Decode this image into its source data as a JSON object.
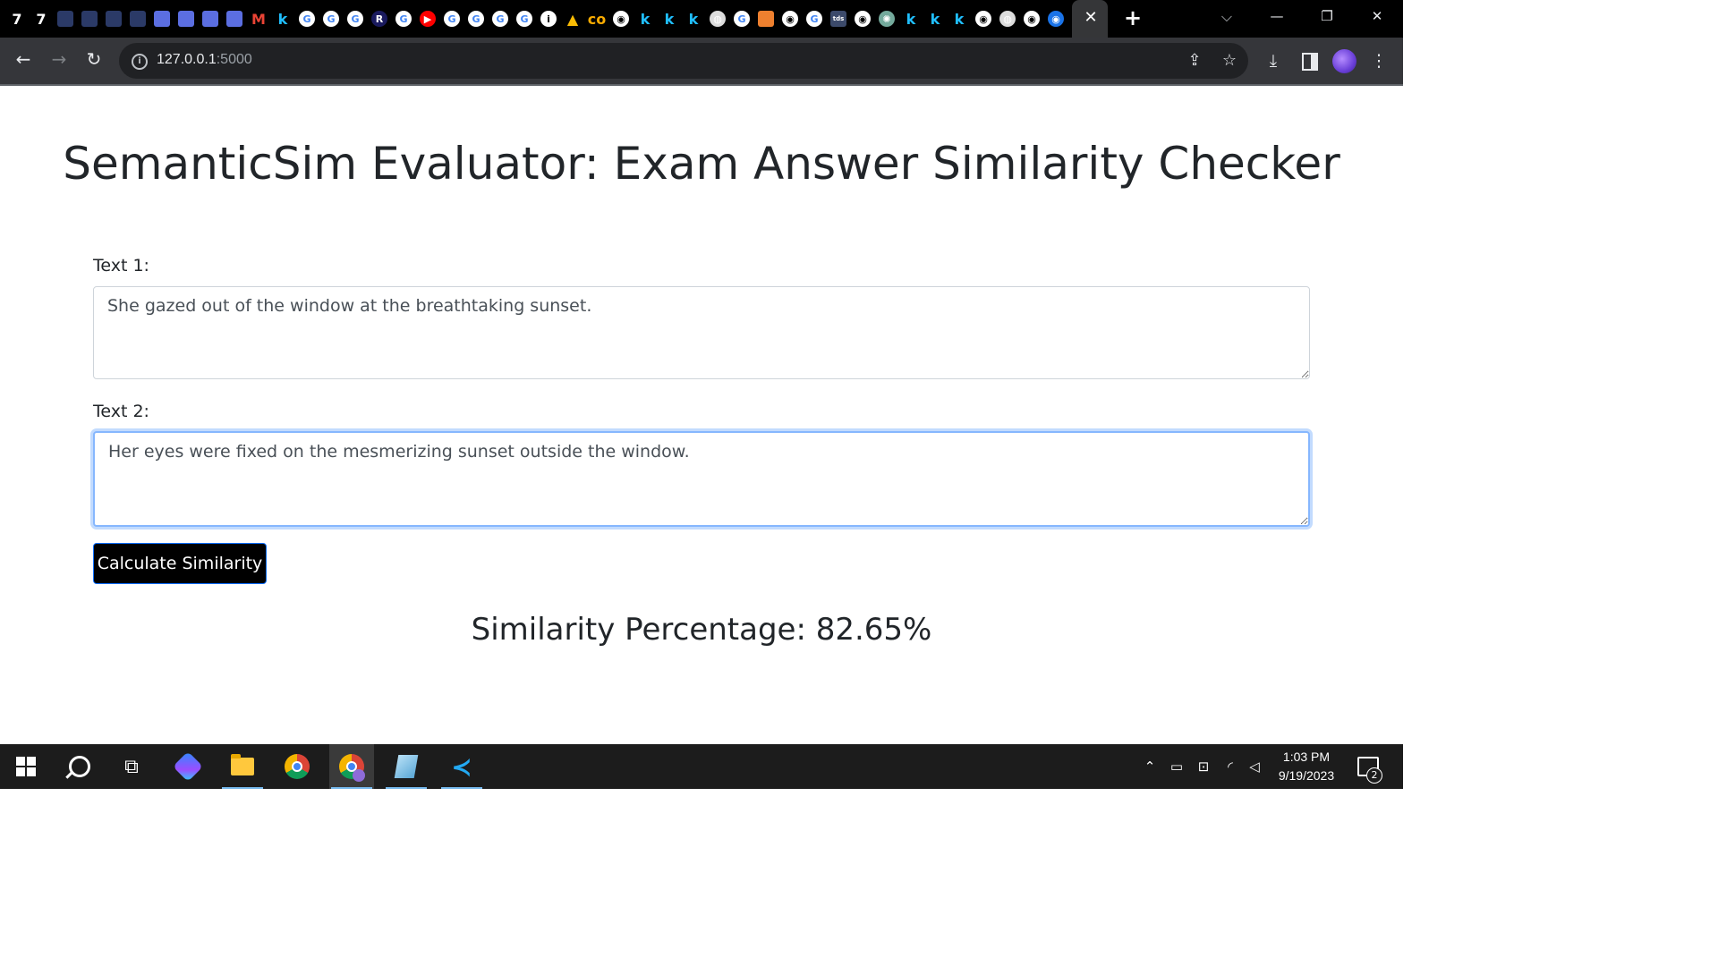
{
  "browser": {
    "active_tab_close": "✕",
    "new_tab": "+",
    "url_host": "127.0.0.1",
    "url_port": ":5000",
    "window_controls": [
      "minimize",
      "restore",
      "close"
    ]
  },
  "tabs_favicons": [
    {
      "icon": "seven-icon",
      "text": "7",
      "bg": "transparent"
    },
    {
      "icon": "seven-icon",
      "text": "7",
      "bg": "transparent"
    },
    {
      "icon": "app-icon",
      "text": "",
      "bg": "#2b3a67"
    },
    {
      "icon": "app-icon",
      "text": "",
      "bg": "#2b3a67"
    },
    {
      "icon": "app-icon",
      "text": "",
      "bg": "#2b3a67"
    },
    {
      "icon": "app-icon",
      "text": "",
      "bg": "#2b3a67"
    },
    {
      "icon": "doc-icon",
      "text": "",
      "bg": "#5b6ee1"
    },
    {
      "icon": "doc-icon",
      "text": "",
      "bg": "#5b6ee1"
    },
    {
      "icon": "doc-icon",
      "text": "",
      "bg": "#5b6ee1"
    },
    {
      "icon": "doc-icon",
      "text": "",
      "bg": "#5b6ee1"
    },
    {
      "icon": "gmail-icon",
      "text": "M",
      "bg": "transparent"
    },
    {
      "icon": "kaggle-icon",
      "text": "k",
      "bg": "transparent"
    },
    {
      "icon": "google-icon",
      "text": "G",
      "bg": "#ffffff"
    },
    {
      "icon": "google-icon",
      "text": "G",
      "bg": "#ffffff"
    },
    {
      "icon": "google-icon",
      "text": "G",
      "bg": "#ffffff"
    },
    {
      "icon": "r-icon",
      "text": "R",
      "bg": "#1a1a5e"
    },
    {
      "icon": "google-icon",
      "text": "G",
      "bg": "#ffffff"
    },
    {
      "icon": "youtube-icon",
      "text": "▶",
      "bg": "#ff0000"
    },
    {
      "icon": "google-icon",
      "text": "G",
      "bg": "#ffffff"
    },
    {
      "icon": "google-icon",
      "text": "G",
      "bg": "#ffffff"
    },
    {
      "icon": "google-icon",
      "text": "G",
      "bg": "#ffffff"
    },
    {
      "icon": "google-icon",
      "text": "G",
      "bg": "#ffffff"
    },
    {
      "icon": "info-icon",
      "text": "i",
      "bg": "#ffffff"
    },
    {
      "icon": "drive-icon",
      "text": "▲",
      "bg": "transparent"
    },
    {
      "icon": "colab-icon",
      "text": "co",
      "bg": "transparent"
    },
    {
      "icon": "github-icon",
      "text": "◉",
      "bg": "#ffffff"
    },
    {
      "icon": "kaggle-icon",
      "text": "k",
      "bg": "transparent"
    },
    {
      "icon": "kaggle-icon",
      "text": "k",
      "bg": "transparent"
    },
    {
      "icon": "kaggle-icon",
      "text": "k",
      "bg": "transparent"
    },
    {
      "icon": "globe-icon",
      "text": "◍",
      "bg": "#dddddd"
    },
    {
      "icon": "google-icon",
      "text": "G",
      "bg": "#ffffff"
    },
    {
      "icon": "rss-icon",
      "text": "",
      "bg": "#ee802f"
    },
    {
      "icon": "github-icon",
      "text": "◉",
      "bg": "#ffffff"
    },
    {
      "icon": "google-icon",
      "text": "G",
      "bg": "#ffffff"
    },
    {
      "icon": "tds-icon",
      "text": "tds",
      "bg": "#3c4a6b"
    },
    {
      "icon": "github-icon",
      "text": "◉",
      "bg": "#ffffff"
    },
    {
      "icon": "chatgpt-icon",
      "text": "✺",
      "bg": "#74aa9c"
    },
    {
      "icon": "kaggle-icon",
      "text": "k",
      "bg": "transparent"
    },
    {
      "icon": "kaggle-icon",
      "text": "k",
      "bg": "transparent"
    },
    {
      "icon": "kaggle-icon",
      "text": "k",
      "bg": "transparent"
    },
    {
      "icon": "github-icon",
      "text": "◉",
      "bg": "#ffffff"
    },
    {
      "icon": "globe-icon",
      "text": "◍",
      "bg": "#dddddd"
    },
    {
      "icon": "github-icon",
      "text": "◉",
      "bg": "#ffffff"
    },
    {
      "icon": "profile-icon",
      "text": "◉",
      "bg": "#1a73e8"
    }
  ],
  "page": {
    "title": "SemanticSim Evaluator: Exam Answer Similarity Checker",
    "text1_label": "Text 1:",
    "text1_value": "She gazed out of the window at the breathtaking sunset.",
    "text2_label": "Text 2:",
    "text2_value": "Her eyes were fixed on the mesmerizing sunset outside the window.",
    "button_label": "Calculate Similarity",
    "result": "Similarity Percentage: 82.65%"
  },
  "taskbar": {
    "time": "1:03 PM",
    "date": "9/19/2023",
    "notification_count": "2"
  },
  "colors": {
    "tab_strip_bg": "#000000",
    "toolbar_bg": "#35363a",
    "button_bg": "#000000",
    "button_border": "#0d6efd",
    "focus_ring": "#86b7fe",
    "taskbar_bg": "#1c1c1c"
  }
}
